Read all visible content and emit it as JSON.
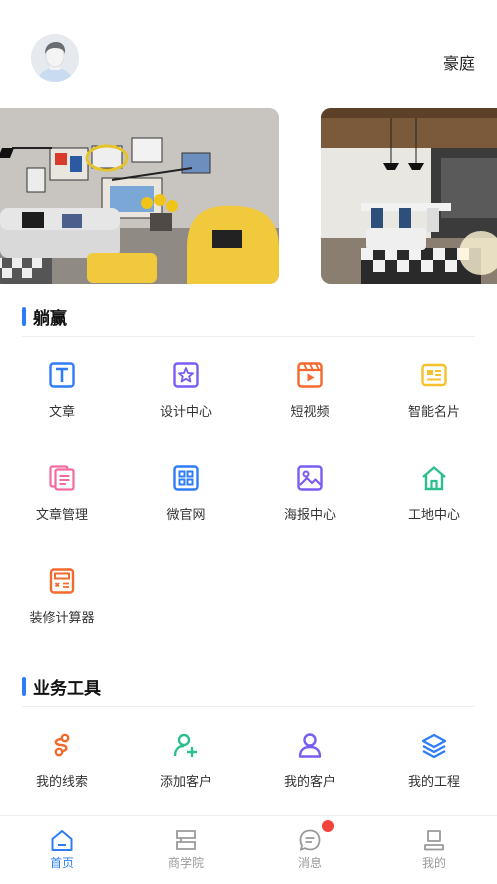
{
  "header": {
    "user_name": "豪庭",
    "avatar_icon": "user-avatar-icon"
  },
  "banners": [
    {
      "name": "living-room-photo"
    },
    {
      "name": "dining-room-photo"
    }
  ],
  "sections": [
    {
      "title": "躺赢",
      "items": [
        {
          "label": "文章",
          "icon": "text-icon",
          "color": "#2f7df6"
        },
        {
          "label": "设计中心",
          "icon": "star-icon",
          "color": "#7a5cf0"
        },
        {
          "label": "短视频",
          "icon": "video-icon",
          "color": "#f26a2e"
        },
        {
          "label": "智能名片",
          "icon": "card-icon",
          "color": "#f5c22b"
        },
        {
          "label": "文章管理",
          "icon": "documents-icon",
          "color": "#f06ca1"
        },
        {
          "label": "微官网",
          "icon": "grid-icon",
          "color": "#2f7df6"
        },
        {
          "label": "海报中心",
          "icon": "image-icon",
          "color": "#7a5cf0"
        },
        {
          "label": "工地中心",
          "icon": "home-icon",
          "color": "#2dbf8f"
        },
        {
          "label": "装修计算器",
          "icon": "calculator-icon",
          "color": "#f26a2e"
        }
      ]
    },
    {
      "title": "业务工具",
      "items": [
        {
          "label": "我的线索",
          "icon": "clue-icon",
          "color": "#f26a2e"
        },
        {
          "label": "添加客户",
          "icon": "add-user-icon",
          "color": "#2dbf8f"
        },
        {
          "label": "我的客户",
          "icon": "customer-icon",
          "color": "#7a5cf0"
        },
        {
          "label": "我的工程",
          "icon": "layers-icon",
          "color": "#2f7df6"
        }
      ]
    }
  ],
  "tabbar": {
    "tabs": [
      {
        "label": "首页",
        "icon": "home-tab-icon",
        "active": true
      },
      {
        "label": "商学院",
        "icon": "school-icon",
        "active": false
      },
      {
        "label": "消息",
        "icon": "message-icon",
        "active": false
      },
      {
        "label": "我的",
        "icon": "profile-icon",
        "active": false
      }
    ]
  },
  "colors": {
    "accent": "#2f7df6",
    "badge": "#f0443a",
    "inactive": "#999999"
  }
}
